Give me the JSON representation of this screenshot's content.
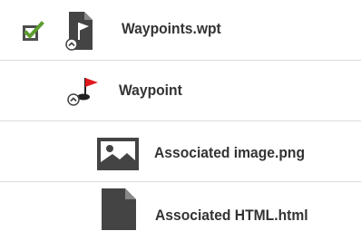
{
  "tree": {
    "items": [
      {
        "label": "Waypoints.wpt",
        "icon": "waypoints-file-icon",
        "checked": true,
        "level": 0
      },
      {
        "label": "Waypoint",
        "icon": "waypoint-flag-icon",
        "level": 1
      },
      {
        "label": "Associated image.png",
        "icon": "image-file-icon",
        "level": 2
      },
      {
        "label": "Associated HTML.html",
        "icon": "html-file-icon",
        "level": 2
      }
    ]
  },
  "colors": {
    "checkbox_fill": "#5c9c2e",
    "text": "#333333",
    "icon_dark": "#444444",
    "flag_red": "#e0181c",
    "divider": "#dcdcdc"
  }
}
